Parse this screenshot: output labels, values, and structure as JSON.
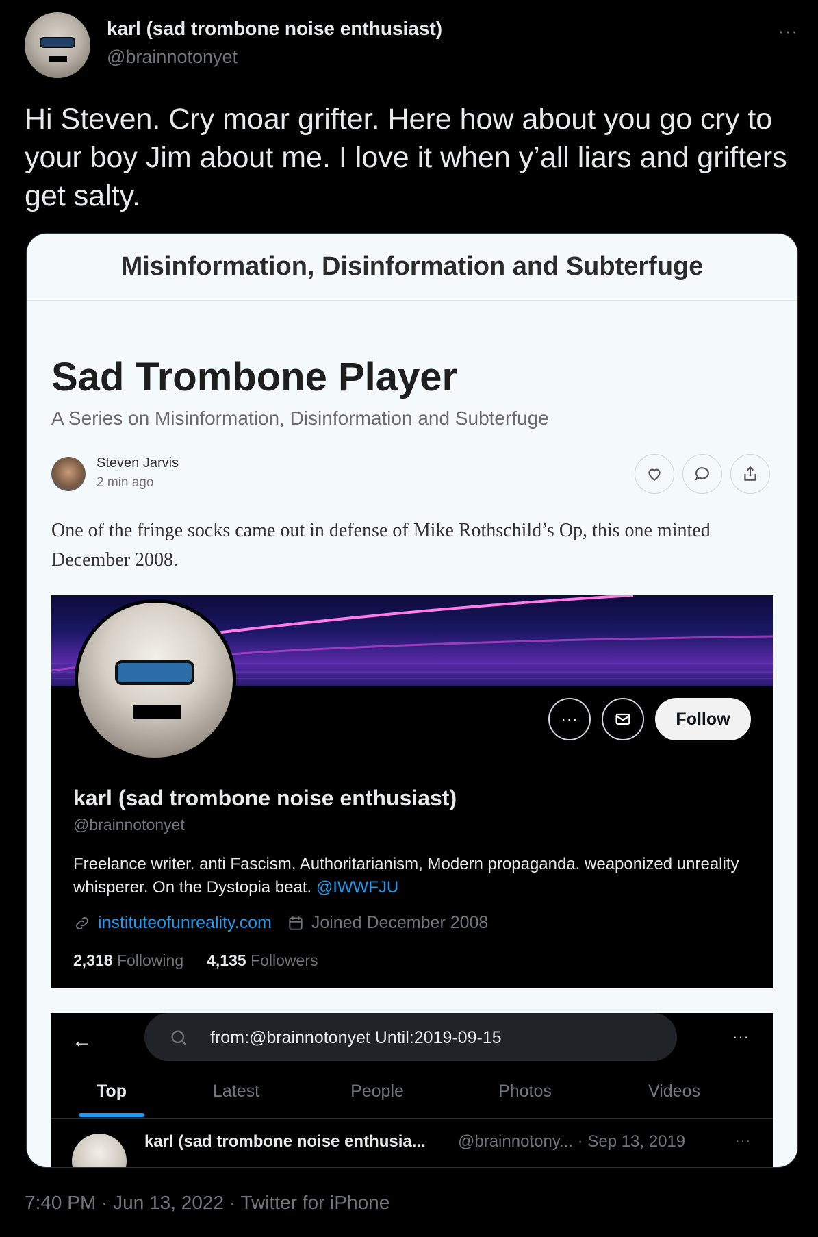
{
  "tweet": {
    "author": {
      "display_name": "karl (sad trombone noise enthusiast)",
      "handle": "@brainnotonyet"
    },
    "more_glyph": "···",
    "text": "Hi Steven. Cry moar grifter. Here how about you go cry to your boy Jim about me. I love it when y’all liars and grifters get salty.",
    "timestamp": "7:40 PM · Jun 13, 2022 · Twitter for iPhone"
  },
  "article": {
    "publication": "Misinformation, Disinformation and Subterfuge",
    "title": "Sad Trombone Player",
    "subtitle": "A Series on Misinformation, Disinformation and Subterfuge",
    "author": "Steven Jarvis",
    "time": "2 min ago",
    "body": "One of the fringe socks came out in defense of Mike Rothschild’s Op, this one minted December 2008."
  },
  "profile": {
    "more_glyph": "···",
    "follow_label": "Follow",
    "name": "karl (sad trombone noise enthusiast)",
    "handle": "@brainnotonyet",
    "bio": "Freelance writer. anti Fascism, Authoritarianism, Modern propaganda. weaponized unreality whisperer. On the Dystopia beat.",
    "bio_mention": "@IWWFJU",
    "website": "instituteofunreality.com",
    "joined": "Joined December 2008",
    "following_count": "2,318",
    "following_label": "Following",
    "followers_count": "4,135",
    "followers_label": "Followers"
  },
  "search": {
    "back_glyph": "←",
    "query": "from:@brainnotonyet Until:2019-09-15",
    "more_glyph": "···",
    "tabs": [
      "Top",
      "Latest",
      "People",
      "Photos",
      "Videos"
    ],
    "active_tab": "Top",
    "result": {
      "name": "karl (sad trombone noise enthusia...",
      "meta": "@brainnotony... · Sep 13, 2019",
      "more_glyph": "···"
    }
  },
  "colors": {
    "accent": "#1d9bf0",
    "background": "#000000",
    "card_background": "#f4f9fc"
  }
}
